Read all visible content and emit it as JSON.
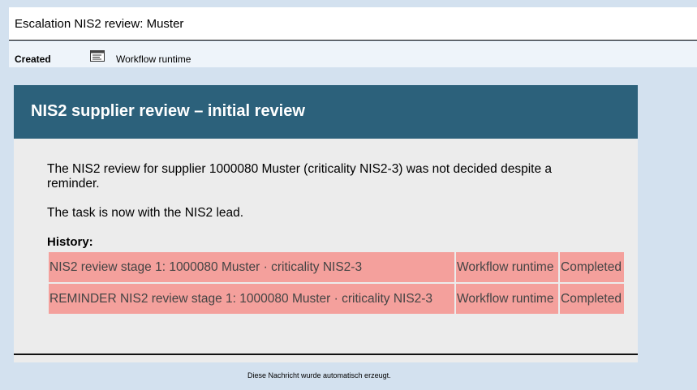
{
  "window": {
    "title": "Escalation NIS2 review: Muster"
  },
  "meta": {
    "status": "Created",
    "creator_icon": "note-icon",
    "creator": "Workflow runtime"
  },
  "email": {
    "heading": "NIS2 supplier review – initial review",
    "paragraph1": "The NIS2 review for supplier 1000080 Muster  (criticality NIS2-3) was not decided despite a reminder.",
    "paragraph2": "The task is now with the NIS2 lead.",
    "history_label": "History:",
    "history": [
      {
        "task": "NIS2 review stage 1: 1000080 Muster  · criticality NIS2-3",
        "agent": "Workflow runtime",
        "status": "Completed"
      },
      {
        "task": "REMINDER NIS2 review stage 1: 1000080 Muster  · criticality NIS2-3",
        "agent": "Workflow runtime",
        "status": "Completed"
      }
    ]
  },
  "footer": {
    "note": "Diese Nachricht wurde automatisch erzeugt."
  },
  "colors": {
    "header_bg": "#2c617b",
    "history_row_bg": "#f4a09c",
    "page_bg": "#d3e1ef"
  }
}
